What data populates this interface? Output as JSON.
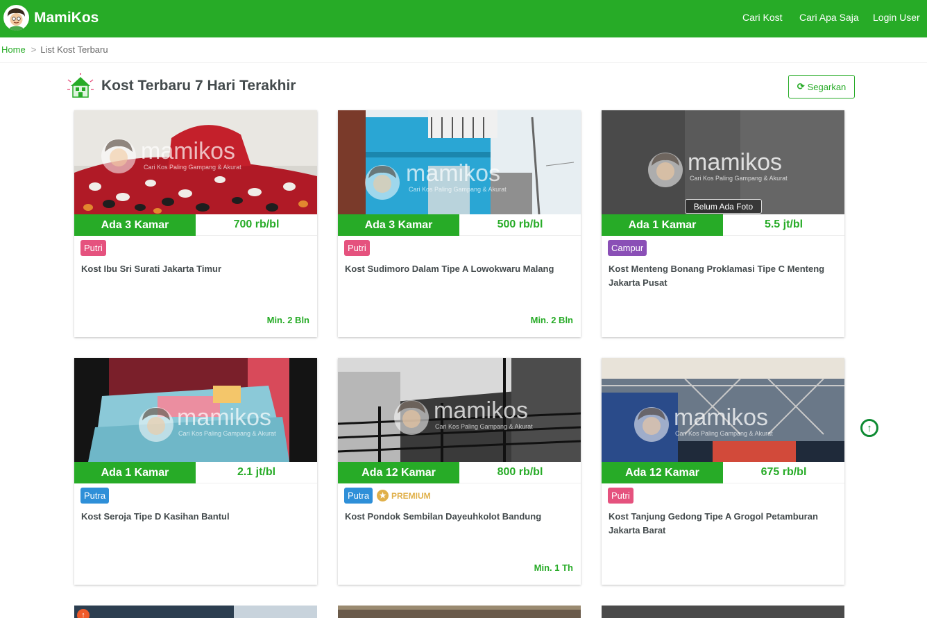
{
  "header": {
    "brand": "MamiKos",
    "nav": [
      "Cari Kost",
      "Cari Apa Saja",
      "Login User"
    ]
  },
  "breadcrumb": {
    "home": "Home",
    "sep": ">",
    "current": "List Kost Terbaru"
  },
  "section": {
    "title": "Kost Terbaru 7 Hari Terakhir",
    "refresh_label": "Segarkan"
  },
  "watermark": {
    "text": "mamikos",
    "tagline": "Cari Kos Paling Gampang & Akurat",
    "no_photo": "Belum Ada Foto"
  },
  "colors": {
    "brand": "#27ab27",
    "putri": "#e5527e",
    "putra": "#2e8fd8",
    "campur": "#8a4fb6",
    "premium": "#e0b04a"
  },
  "cards": [
    {
      "rooms": "Ada 3 Kamar",
      "price": "700 rb/bl",
      "gender": "Putri",
      "name": "Kost Ibu Sri Surati Jakarta Timur",
      "min": "Min. 2 Bln",
      "premium": ""
    },
    {
      "rooms": "Ada 3 Kamar",
      "price": "500 rb/bl",
      "gender": "Putri",
      "name": "Kost Sudimoro Dalam Tipe A Lowokwaru Malang",
      "min": "Min. 2 Bln",
      "premium": ""
    },
    {
      "rooms": "Ada 1 Kamar",
      "price": "5.5 jt/bl",
      "gender": "Campur",
      "name": "Kost Menteng Bonang Proklamasi Tipe C Menteng Jakarta Pusat",
      "min": "",
      "premium": ""
    },
    {
      "rooms": "Ada 1 Kamar",
      "price": "2.1 jt/bl",
      "gender": "Putra",
      "name": "Kost Seroja Tipe D Kasihan Bantul",
      "min": "",
      "premium": ""
    },
    {
      "rooms": "Ada 12 Kamar",
      "price": "800 rb/bl",
      "gender": "Putra",
      "name": "Kost Pondok Sembilan Dayeuhkolot Bandung",
      "min": "Min. 1 Th",
      "premium": "PREMIUM"
    },
    {
      "rooms": "Ada 12 Kamar",
      "price": "675 rb/bl",
      "gender": "Putri",
      "name": "Kost Tanjung Gedong Tipe A Grogol Petamburan Jakarta Barat",
      "min": "",
      "premium": ""
    }
  ]
}
